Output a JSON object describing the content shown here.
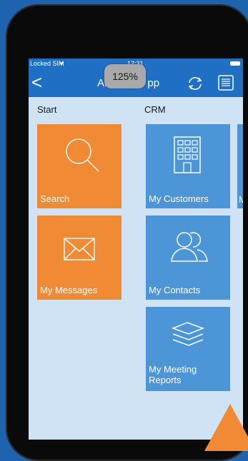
{
  "status_bar": {
    "carrier": "Locked SIM",
    "wifi_icon": "wifi-icon",
    "time": "12:31"
  },
  "nav": {
    "title": "An",
    "title_tail": "pp",
    "back_glyph": "<",
    "refresh_icon": "refresh-icon",
    "list_icon": "list-icon"
  },
  "zoom_badge": "125%",
  "sections": {
    "start": "Start",
    "crm": "CRM"
  },
  "tiles": {
    "search": {
      "label": "Search",
      "icon": "search-icon"
    },
    "messages": {
      "label": "My Messages",
      "icon": "envelope-icon"
    },
    "customers": {
      "label": "My Customers",
      "icon": "building-icon"
    },
    "contacts": {
      "label": "My Contacts",
      "icon": "contacts-icon"
    },
    "meeting_reports": {
      "label_line1": "My Meeting",
      "label_line2": "Reports",
      "icon": "layers-icon"
    },
    "partial_label": "M"
  },
  "colors": {
    "background": "#1d63ad",
    "navbar": "#1f6fc4",
    "orange_tile": "#f08a34",
    "blue_tile": "#4c96d8",
    "screen": "#cfe3f4"
  }
}
